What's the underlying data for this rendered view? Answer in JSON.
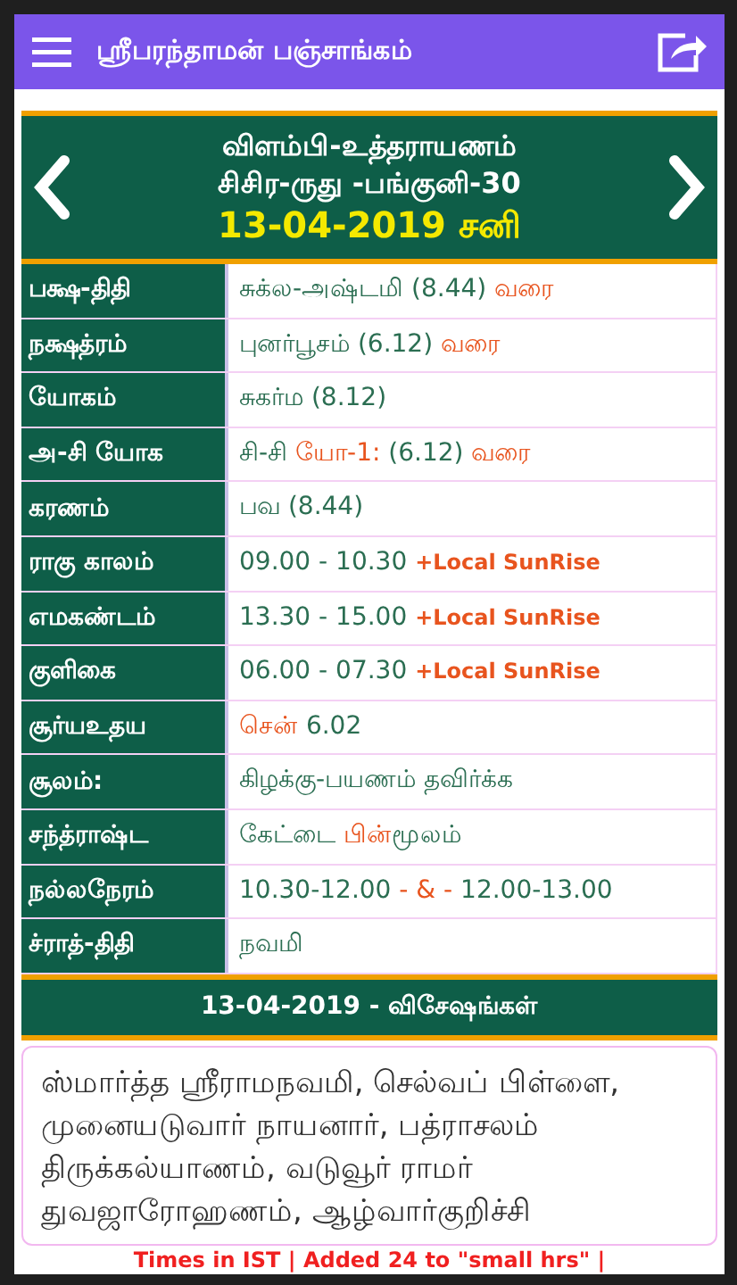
{
  "app_bar": {
    "title": "ஸ்ரீபரந்தாமன் பஞ்சாங்கம்"
  },
  "header": {
    "line_1": "விளம்பி-உத்தராயணம்",
    "line_2": "சிசிர-ருது -பங்குனி-30",
    "date": "13-04-2019 சனி"
  },
  "rows": [
    {
      "label": "பக்ஷ-திதி",
      "parts": [
        {
          "text": "சுக்ல-அஷ்டமி (8.44) ",
          "kind": "plain"
        },
        {
          "text": "வரை",
          "kind": "accent"
        }
      ]
    },
    {
      "label": "நக்ஷத்ரம்",
      "parts": [
        {
          "text": "புனர்பூசம் (6.12) ",
          "kind": "plain"
        },
        {
          "text": "வரை",
          "kind": "accent"
        }
      ]
    },
    {
      "label": "யோகம்",
      "parts": [
        {
          "text": "சுகர்ம (8.12)",
          "kind": "plain"
        }
      ]
    },
    {
      "label": "அ-சி யோக",
      "parts": [
        {
          "text": "சி-சி ",
          "kind": "plain"
        },
        {
          "text": "யோ-1:",
          "kind": "accent"
        },
        {
          "text": " (6.12) ",
          "kind": "plain"
        },
        {
          "text": "வரை",
          "kind": "accent"
        }
      ]
    },
    {
      "label": "கரணம்",
      "parts": [
        {
          "text": "பவ (8.44)",
          "kind": "plain"
        }
      ]
    },
    {
      "label": "ராகு காலம்",
      "parts": [
        {
          "text": "09.00 - 10.30 ",
          "kind": "plain"
        },
        {
          "text": "+Local SunRise",
          "kind": "small"
        }
      ]
    },
    {
      "label": "எமகண்டம்",
      "parts": [
        {
          "text": "13.30 - 15.00 ",
          "kind": "plain"
        },
        {
          "text": "+Local SunRise",
          "kind": "small"
        }
      ]
    },
    {
      "label": "குளிகை",
      "parts": [
        {
          "text": "06.00 - 07.30 ",
          "kind": "plain"
        },
        {
          "text": "+Local SunRise",
          "kind": "small"
        }
      ]
    },
    {
      "label": "சூர்யஉதய",
      "parts": [
        {
          "text": "சென்",
          "kind": "accent"
        },
        {
          "text": " 6.02",
          "kind": "plain"
        }
      ]
    },
    {
      "label": "சூலம்:",
      "parts": [
        {
          "text": "கிழக்கு-பயணம் தவிர்க்க",
          "kind": "plain"
        }
      ]
    },
    {
      "label": "சந்த்ராஷ்ட",
      "parts": [
        {
          "text": "கேட்டை ",
          "kind": "plain"
        },
        {
          "text": "பின்",
          "kind": "accent"
        },
        {
          "text": "மூலம்",
          "kind": "plain"
        }
      ]
    },
    {
      "label": "நல்லநேரம்",
      "parts": [
        {
          "text": "10.30-12.00 ",
          "kind": "plain"
        },
        {
          "text": "- & -",
          "kind": "accent"
        },
        {
          "text": " 12.00-13.00",
          "kind": "plain"
        }
      ]
    },
    {
      "label": "ச்ராத்-திதி",
      "parts": [
        {
          "text": "நவமி",
          "kind": "plain"
        }
      ]
    }
  ],
  "specials": {
    "title": "13-04-2019 - விசேஷங்கள்",
    "text": "ஸ்மார்த்த ஸ்ரீராமநவமி, செல்வப் பிள்ளை, முனையடுவார் நாயனார், பத்ராசலம் திருக்கல்யாணம், வடுவூர் ராமர் துவஜாரோஹணம், ஆழ்வார்குறிச்சி"
  },
  "footer": "Times in IST | Added 24 to \"small hrs\" |"
}
